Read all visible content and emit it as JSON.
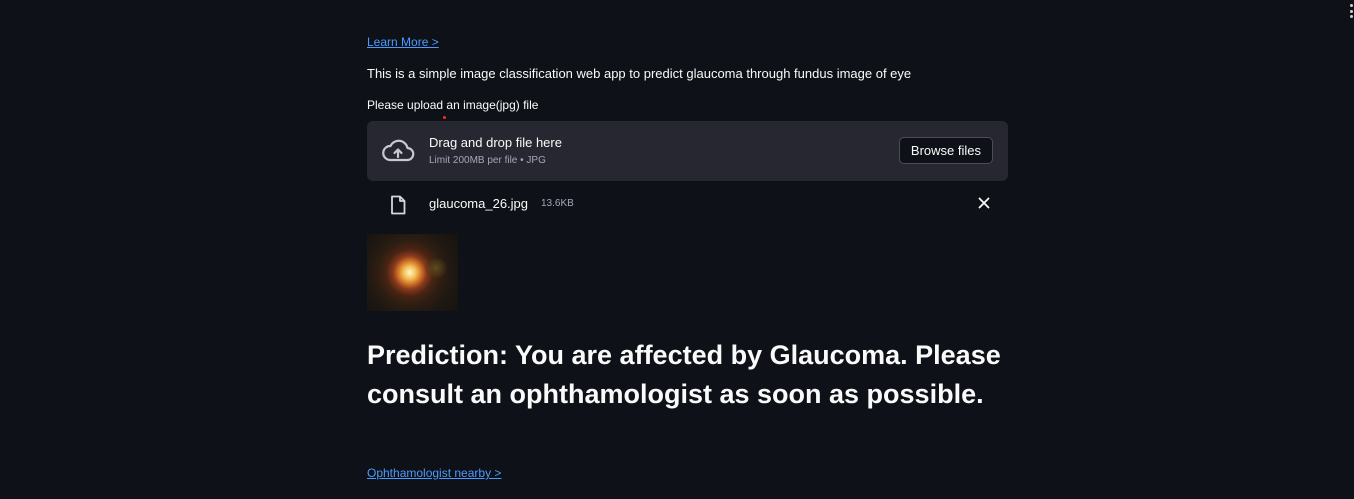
{
  "links": {
    "learn_more": "Learn More >",
    "ophthalmologist_nearby": "Ophthamologist nearby >"
  },
  "description": "This is a simple image classification web app to predict glaucoma through fundus image of eye",
  "uploader": {
    "label": "Please upload an image(jpg) file",
    "drag_drop_title": "Drag and drop file here",
    "limit_text": "Limit 200MB per file • JPG",
    "browse_button": "Browse files",
    "upload_icon": "cloud-upload-icon"
  },
  "uploaded_file": {
    "name": "glaucoma_26.jpg",
    "size": "13.6KB",
    "file_icon": "file-icon",
    "remove_icon": "close-icon"
  },
  "prediction": {
    "text": "Prediction: You are affected by Glaucoma. Please consult an ophthamologist as soon as possible."
  },
  "colors": {
    "background": "#0e1117",
    "dropzone": "#262730",
    "link": "#4b9bff",
    "text": "#fafafa",
    "muted": "#a3a8b8"
  }
}
